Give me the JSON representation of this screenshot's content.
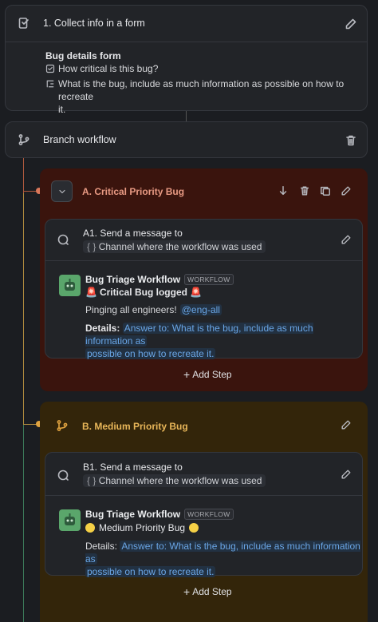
{
  "step1": {
    "title": "1. Collect info in a form",
    "form_name": "Bug details form",
    "fields": [
      "How critical is this bug?",
      "What is the bug, include as much information as possible on how to recreate",
      "it."
    ]
  },
  "branch": {
    "title": "Branch workflow"
  },
  "branch_a": {
    "title": "A. Critical Priority Bug",
    "step_title": "A1. Send a message to",
    "channel": "Channel where the workflow was used",
    "bot_name": "Bug Triage Workflow",
    "badge": "WORKFLOW",
    "message_title": "Critical Bug logged",
    "ping_text": "Pinging all engineers!",
    "ping_mention": "@eng-all",
    "details_label": "Details:",
    "details_link_1": "Answer to: What is the bug, include as much information as",
    "details_link_2": "possible on how to recreate it.",
    "add_step": "Add Step"
  },
  "branch_b": {
    "title": "B. Medium Priority Bug",
    "step_title": "B1. Send a message to",
    "channel": "Channel where the workflow was used",
    "bot_name": "Bug Triage Workflow",
    "badge": "WORKFLOW",
    "message_title": "Medium Priority Bug",
    "details_label": "Details:",
    "details_link_1": "Answer to: What is the bug, include as much information as",
    "details_link_2": "possible on how to recreate it.",
    "add_step": "Add Step"
  },
  "colors": {
    "critical_bg": "#3a140d",
    "medium_bg": "#33250a",
    "critical_dot": "#d9775a",
    "medium_dot": "#e0a340",
    "link": "#6aa6e6"
  }
}
